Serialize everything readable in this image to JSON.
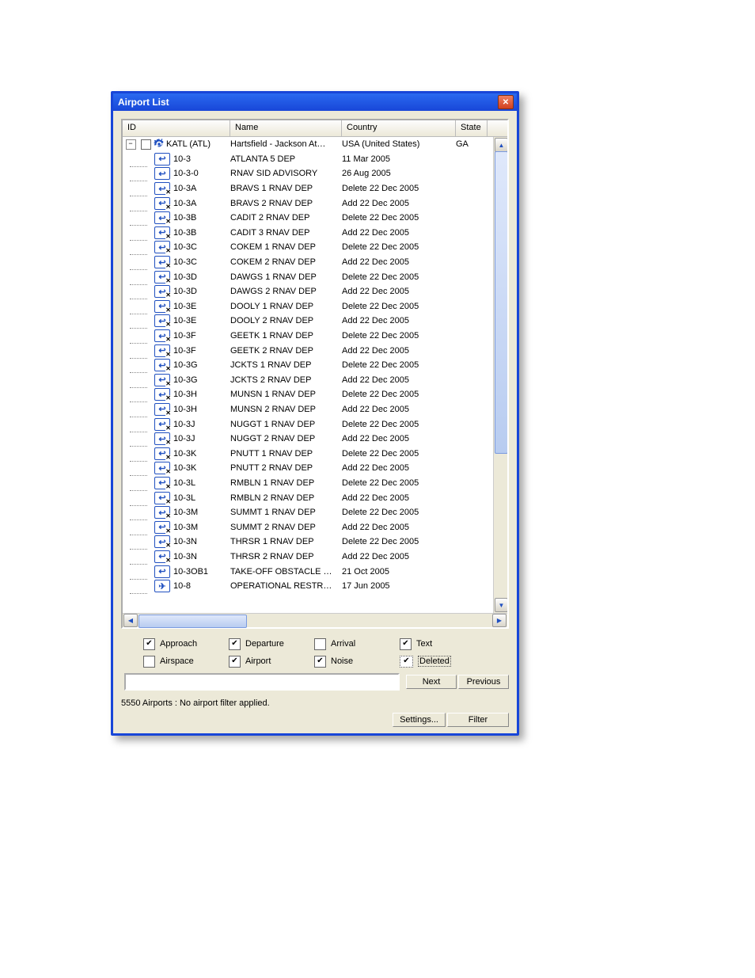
{
  "window": {
    "title": "Airport List"
  },
  "columns": {
    "id": "ID",
    "name": "Name",
    "country": "Country",
    "state": "State"
  },
  "root": {
    "id": "KATL (ATL)",
    "name": "Hartsfield - Jackson At…",
    "country": "USA (United States)",
    "state": "GA"
  },
  "rows": [
    {
      "id": "10-3",
      "name": "ATLANTA 5 DEP",
      "country": "11 Mar 2005",
      "x": false
    },
    {
      "id": "10-3-0",
      "name": "RNAV SID ADVISORY",
      "country": "26 Aug 2005",
      "x": false
    },
    {
      "id": "10-3A",
      "name": "BRAVS 1 RNAV DEP",
      "country": "Delete 22 Dec 2005",
      "x": true
    },
    {
      "id": "10-3A",
      "name": "BRAVS 2 RNAV DEP",
      "country": "Add 22 Dec 2005",
      "x": true
    },
    {
      "id": "10-3B",
      "name": "CADIT 2 RNAV DEP",
      "country": "Delete 22 Dec 2005",
      "x": true
    },
    {
      "id": "10-3B",
      "name": "CADIT 3 RNAV DEP",
      "country": "Add 22 Dec 2005",
      "x": true
    },
    {
      "id": "10-3C",
      "name": "COKEM 1 RNAV DEP",
      "country": "Delete 22 Dec 2005",
      "x": true
    },
    {
      "id": "10-3C",
      "name": "COKEM 2 RNAV DEP",
      "country": "Add 22 Dec 2005",
      "x": true
    },
    {
      "id": "10-3D",
      "name": "DAWGS 1 RNAV DEP",
      "country": "Delete 22 Dec 2005",
      "x": true
    },
    {
      "id": "10-3D",
      "name": "DAWGS 2 RNAV DEP",
      "country": "Add 22 Dec 2005",
      "x": true
    },
    {
      "id": "10-3E",
      "name": "DOOLY 1 RNAV DEP",
      "country": "Delete 22 Dec 2005",
      "x": true
    },
    {
      "id": "10-3E",
      "name": "DOOLY 2 RNAV DEP",
      "country": "Add 22 Dec 2005",
      "x": true
    },
    {
      "id": "10-3F",
      "name": "GEETK 1 RNAV DEP",
      "country": "Delete 22 Dec 2005",
      "x": true
    },
    {
      "id": "10-3F",
      "name": "GEETK 2 RNAV DEP",
      "country": "Add 22 Dec 2005",
      "x": true
    },
    {
      "id": "10-3G",
      "name": "JCKTS 1 RNAV DEP",
      "country": "Delete 22 Dec 2005",
      "x": true
    },
    {
      "id": "10-3G",
      "name": "JCKTS 2 RNAV DEP",
      "country": "Add 22 Dec 2005",
      "x": true
    },
    {
      "id": "10-3H",
      "name": "MUNSN 1 RNAV DEP",
      "country": "Delete 22 Dec 2005",
      "x": true
    },
    {
      "id": "10-3H",
      "name": "MUNSN 2 RNAV DEP",
      "country": "Add 22 Dec 2005",
      "x": true
    },
    {
      "id": "10-3J",
      "name": "NUGGT 1 RNAV DEP",
      "country": "Delete 22 Dec 2005",
      "x": true
    },
    {
      "id": "10-3J",
      "name": "NUGGT 2 RNAV DEP",
      "country": "Add 22 Dec 2005",
      "x": true
    },
    {
      "id": "10-3K",
      "name": "PNUTT 1 RNAV DEP",
      "country": "Delete 22 Dec 2005",
      "x": true
    },
    {
      "id": "10-3K",
      "name": "PNUTT 2 RNAV DEP",
      "country": "Add 22 Dec 2005",
      "x": true
    },
    {
      "id": "10-3L",
      "name": "RMBLN 1 RNAV DEP",
      "country": "Delete 22 Dec 2005",
      "x": true
    },
    {
      "id": "10-3L",
      "name": "RMBLN 2 RNAV DEP",
      "country": "Add 22 Dec 2005",
      "x": true
    },
    {
      "id": "10-3M",
      "name": "SUMMT 1 RNAV DEP",
      "country": "Delete 22 Dec 2005",
      "x": true
    },
    {
      "id": "10-3M",
      "name": "SUMMT 2 RNAV DEP",
      "country": "Add 22 Dec 2005",
      "x": true
    },
    {
      "id": "10-3N",
      "name": "THRSR 1 RNAV DEP",
      "country": "Delete 22 Dec 2005",
      "x": true
    },
    {
      "id": "10-3N",
      "name": "THRSR 2 RNAV DEP",
      "country": "Add 22 Dec 2005",
      "x": true
    },
    {
      "id": "10-3OB1",
      "name": "TAKE-OFF OBSTACLE …",
      "country": "21 Oct 2005",
      "x": false
    },
    {
      "id": "10-8",
      "name": "OPERATIONAL RESTR…",
      "country": "17 Jun 2005",
      "x": false,
      "alt": true
    }
  ],
  "filters": {
    "approach": {
      "label": "Approach",
      "checked": true
    },
    "departure": {
      "label": "Departure",
      "checked": true
    },
    "arrival": {
      "label": "Arrival",
      "checked": false
    },
    "text": {
      "label": "Text",
      "checked": true
    },
    "airspace": {
      "label": "Airspace",
      "checked": false
    },
    "airport": {
      "label": "Airport",
      "checked": true
    },
    "noise": {
      "label": "Noise",
      "checked": true
    },
    "deleted": {
      "label": "Deleted",
      "checked": true
    }
  },
  "buttons": {
    "next": "Next",
    "previous": "Previous",
    "settings": "Settings...",
    "filter": "Filter"
  },
  "status": "5550 Airports : No airport filter applied."
}
